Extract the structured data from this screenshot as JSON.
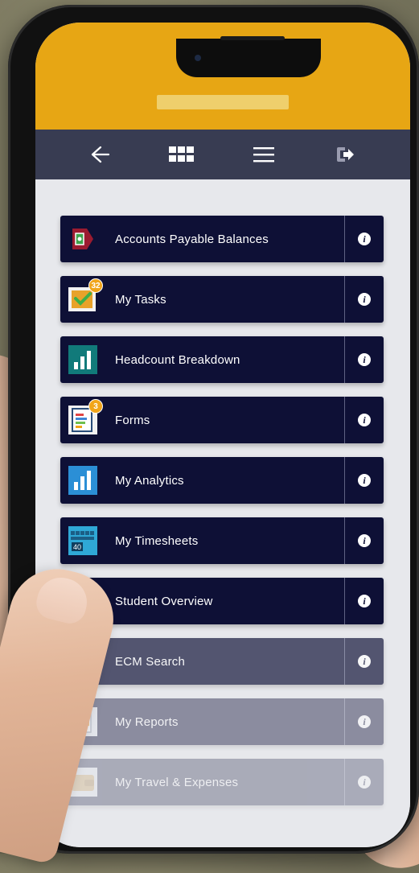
{
  "nav": {
    "back_icon": "arrow-left-icon",
    "grid_icon": "grid-icon",
    "menu_icon": "hamburger-menu-icon",
    "logout_icon": "logout-icon"
  },
  "colors": {
    "header": "#e7a614",
    "nav_bar": "#383c52",
    "tile": "#0e1036",
    "badge": "#f1a51a",
    "background": "#e7e8ec"
  },
  "tiles": [
    {
      "label": "Accounts Payable Balances",
      "icon": "payable-icon"
    },
    {
      "label": "My Tasks",
      "icon": "tasks-icon",
      "badge": "32"
    },
    {
      "label": "Headcount Breakdown",
      "icon": "bar-chart-icon"
    },
    {
      "label": "Forms",
      "icon": "forms-icon",
      "badge": "3"
    },
    {
      "label": "My Analytics",
      "icon": "analytics-icon"
    },
    {
      "label": "My Timesheets",
      "icon": "timesheet-icon",
      "icon_text": "40"
    },
    {
      "label": "Student Overview",
      "icon": "student-icon"
    },
    {
      "label": "ECM Search",
      "icon": "search-document-icon"
    },
    {
      "label": "My Reports",
      "icon": "reports-icon"
    },
    {
      "label": "My Travel & Expenses",
      "icon": "wallet-icon"
    }
  ],
  "info_label": "i"
}
